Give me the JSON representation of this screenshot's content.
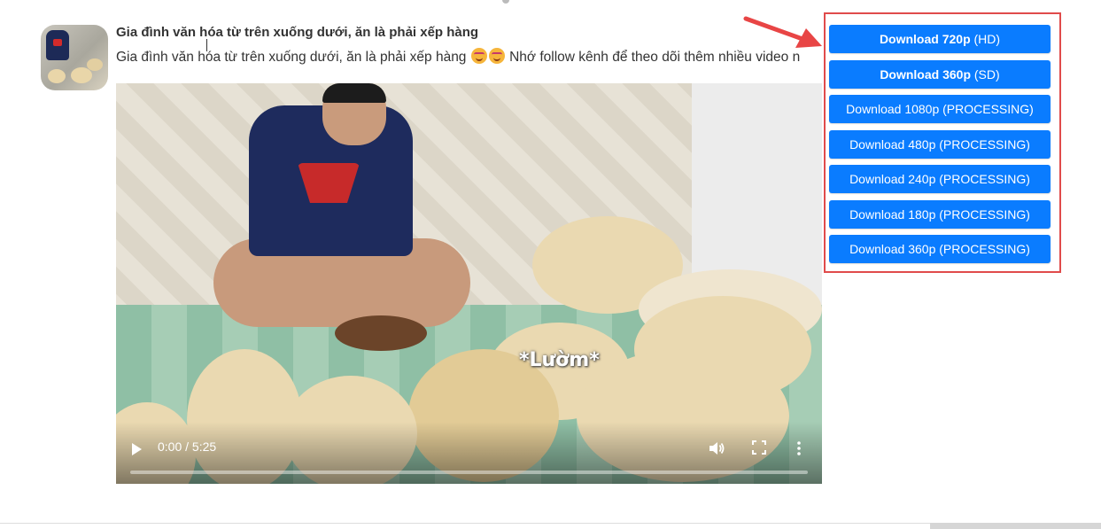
{
  "video": {
    "title": "Gia đình văn hóa từ trên xuống dưới, ăn là phải xếp hàng",
    "description_text": "Gia đình văn hóa từ trên xuống dưới, ăn là phải xếp hàng",
    "description_suffix": "Nhớ follow kênh để theo dõi thêm nhiều video n",
    "overlay_caption": "*Lườm*",
    "time_display": "0:00 / 5:25",
    "progress": 0
  },
  "downloads": [
    {
      "label_bold": "Download 720p",
      "label_rest": " (HD)"
    },
    {
      "label_bold": "Download 360p",
      "label_rest": " (SD)"
    },
    {
      "label_bold": "",
      "label_rest": "Download 1080p (PROCESSING)"
    },
    {
      "label_bold": "",
      "label_rest": "Download 480p (PROCESSING)"
    },
    {
      "label_bold": "",
      "label_rest": "Download 240p (PROCESSING)"
    },
    {
      "label_bold": "",
      "label_rest": "Download 180p (PROCESSING)"
    },
    {
      "label_bold": "",
      "label_rest": "Download 360p (PROCESSING)"
    }
  ],
  "colors": {
    "button_blue": "#0a7cff",
    "highlight_red": "#e04b4b",
    "text_dark": "#333333"
  },
  "icons": [
    "play-icon",
    "volume-icon",
    "fullscreen-icon",
    "more-options-icon",
    "red-arrow-icon",
    "emoji-icon"
  ]
}
